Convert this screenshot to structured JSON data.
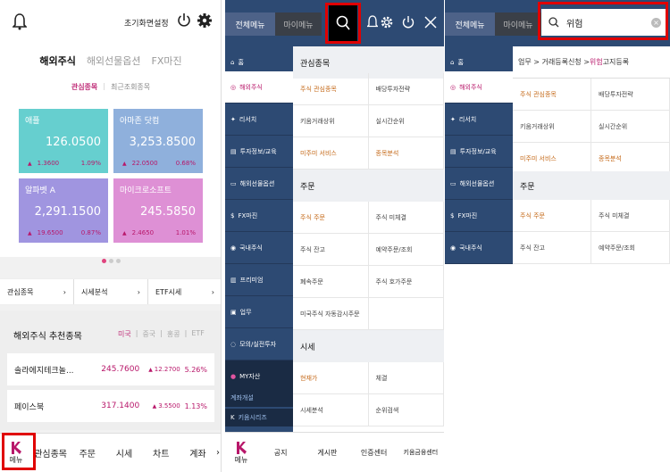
{
  "panel1": {
    "header": {
      "screen_settings_label": "초기화면설정",
      "bell_icon": "bell-icon",
      "power_icon": "power-icon",
      "gear_icon": "gear-icon"
    },
    "tabs": [
      "해외주식",
      "해외선물옵션",
      "FX마진"
    ],
    "subtabs": [
      "관심종목",
      "최근조회종목"
    ],
    "cards": [
      {
        "name": "애플",
        "price": "126.0500",
        "change": "1.3600",
        "pct": "1.09%",
        "color": "#66cfcf"
      },
      {
        "name": "아마존 닷컴",
        "price": "3,253.8500",
        "change": "22.0500",
        "pct": "0.68%",
        "color": "#8fb0dc"
      },
      {
        "name": "알파벳 A",
        "price": "2,291.1500",
        "change": "19.6500",
        "pct": "0.87%",
        "color": "#a095e0"
      },
      {
        "name": "마이크로소프트",
        "price": "245.5850",
        "change": "2.4650",
        "pct": "1.01%",
        "color": "#de90d5"
      }
    ],
    "quicklinks": [
      "관심종목",
      "시세분석",
      "ETF시세"
    ],
    "recommend": {
      "title": "해외주식 추천종목",
      "filters": [
        "미국",
        "중국",
        "홍콩",
        "ETF"
      ],
      "rows": [
        {
          "name": "솔라에지테크놀...",
          "price": "245.7600",
          "change": "12.2700",
          "pct": "5.26%"
        },
        {
          "name": "페이스북",
          "price": "317.1400",
          "change": "3.5500",
          "pct": "1.13%"
        }
      ]
    },
    "bottom_nav": {
      "menu_label": "메뉴",
      "items": [
        "관심종목",
        "주문",
        "시세",
        "차트",
        "계좌"
      ]
    }
  },
  "panel2": {
    "tabs": {
      "full_menu": "전체메뉴",
      "my_menu": "마이메뉴"
    },
    "sidebar": [
      "홈",
      "해외주식",
      "리서치",
      "투자정보/교육",
      "해외선물옵션",
      "FX마진",
      "국내주식",
      "프리미엄",
      "업무",
      "모의/실전투자",
      "MY자산",
      "계좌개설",
      "키움시리즈"
    ],
    "sections": {
      "watchlist": "관심종목",
      "watch_rows": [
        [
          "주식 관심종목",
          "배당투자전략"
        ],
        [
          "키움거래상위",
          "실시간순위"
        ],
        [
          "미주미 서비스",
          "종목분석"
        ]
      ],
      "order": "주문",
      "order_rows": [
        [
          "주식 주문",
          "주식 미체결"
        ],
        [
          "주식 잔고",
          "예약주문/조회"
        ],
        [
          "폐속주문",
          "주식 호가주문"
        ],
        [
          "미국주식 자동감시주문",
          ""
        ]
      ],
      "quote": "시세",
      "quote_rows": [
        [
          "현재가",
          "체결"
        ],
        [
          "시세분석",
          "순위검색"
        ]
      ]
    },
    "bottom_nav": {
      "menu_label": "메뉴",
      "items": [
        "공지",
        "게시판",
        "인증센터",
        "키움금융센터"
      ]
    }
  },
  "panel3": {
    "tabs": {
      "full_menu": "전체메뉴",
      "my_menu": "마이메뉴"
    },
    "search": {
      "value": "위험"
    },
    "breadcrumb": {
      "prefix": "업무 > 거래등록신청 > ",
      "highlight": "위험",
      "suffix": "고지등록"
    },
    "sidebar": [
      "홈",
      "해외주식",
      "리서치",
      "투자정보/교육",
      "해외선물옵션",
      "FX마진",
      "국내주식"
    ],
    "rows": [
      [
        "주식 관심종목",
        "배당투자전략"
      ],
      [
        "키움거래상위",
        "실시간순위"
      ],
      [
        "미주미 서비스",
        "종목분석"
      ]
    ],
    "order": "주문",
    "order_rows": [
      [
        "주식 주문",
        "주식 미체결"
      ],
      [
        "주식 잔고",
        "예약주문/조회"
      ]
    ]
  }
}
